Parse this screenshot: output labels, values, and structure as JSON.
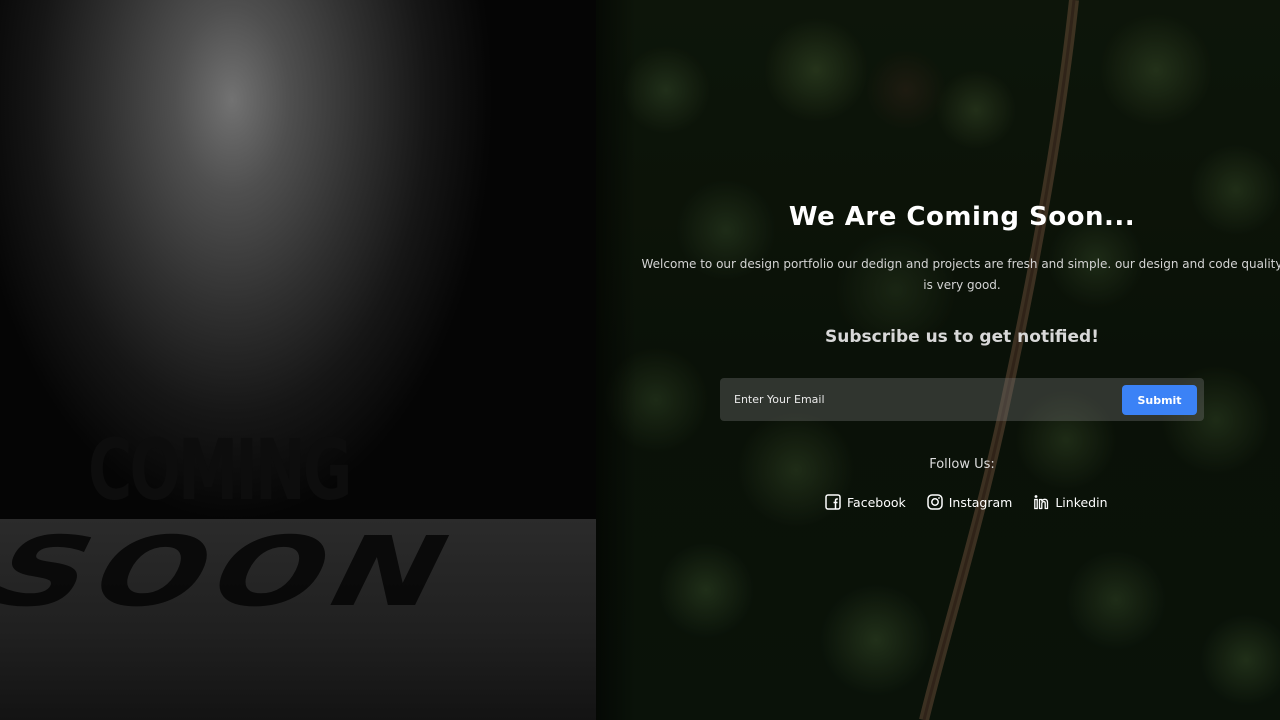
{
  "hero": {
    "coming_text": "COMING",
    "soon_text": "SOON"
  },
  "main": {
    "headline": "We Are Coming Soon...",
    "description": "Welcome to our design portfolio our dedign and projects are fresh and simple. our design and code quality is very good.",
    "subscribe_title": "Subscribe us to get notified!"
  },
  "subscribe_form": {
    "email_placeholder": "Enter Your Email",
    "email_value": "",
    "submit_label": "Submit"
  },
  "follow": {
    "label": "Follow Us:",
    "links": [
      {
        "label": "Facebook",
        "icon": "facebook-icon"
      },
      {
        "label": "Instagram",
        "icon": "instagram-icon"
      },
      {
        "label": "Linkedin",
        "icon": "linkedin-icon"
      }
    ]
  },
  "colors": {
    "accent": "#3b82f6",
    "heading": "#ffffff",
    "body_text": "#d4d4d4"
  }
}
